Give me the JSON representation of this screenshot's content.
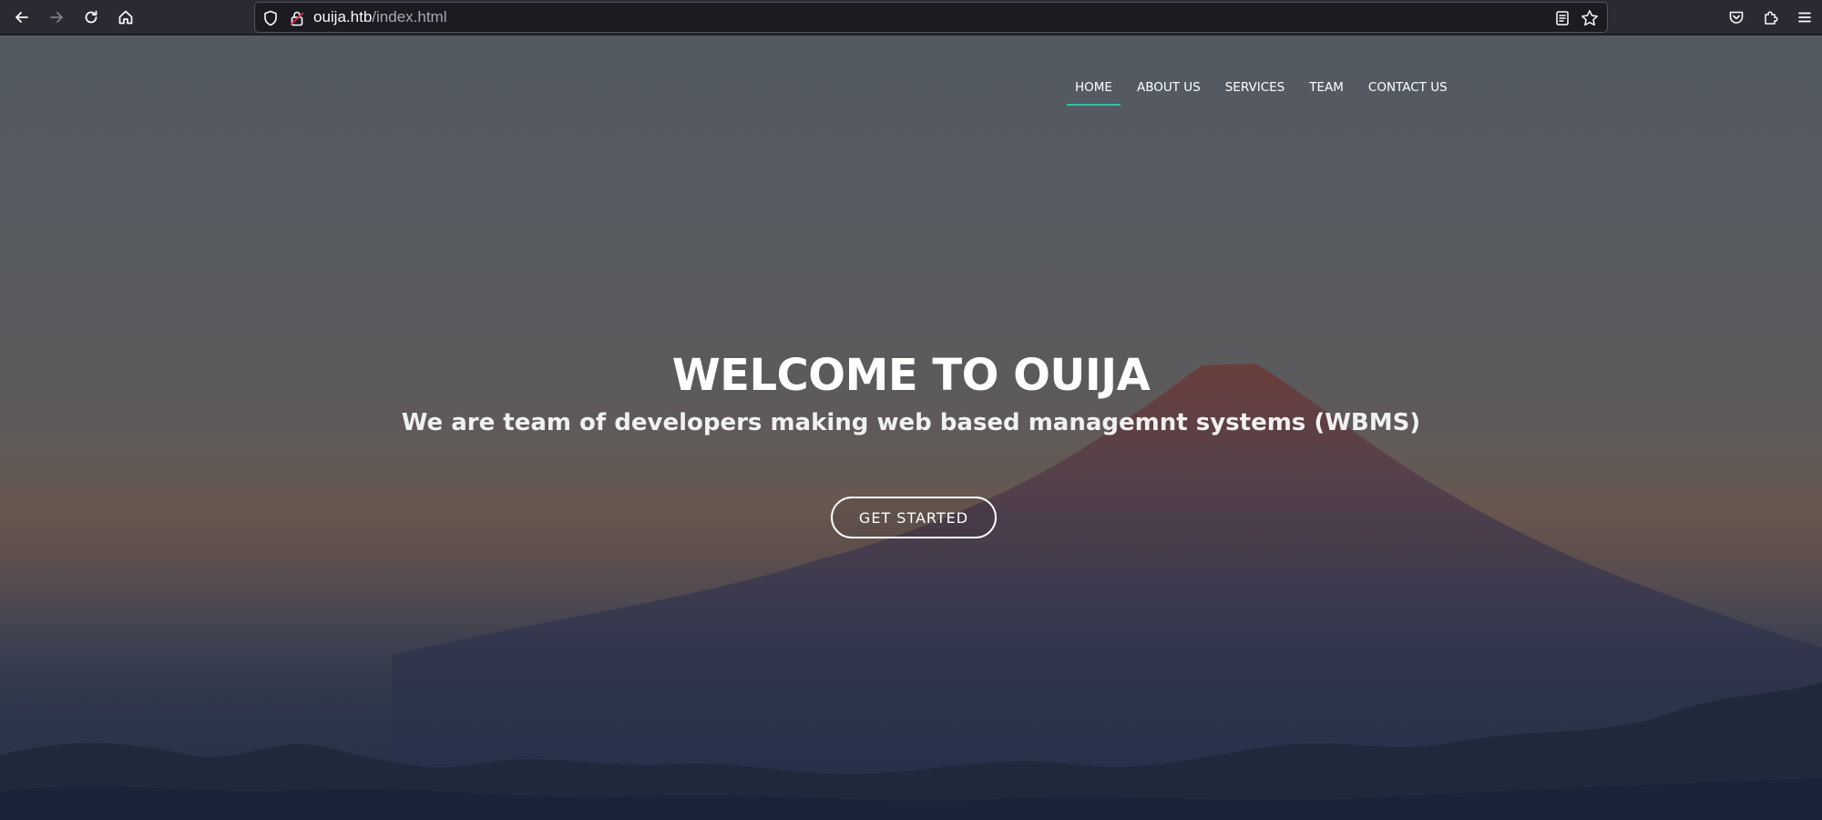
{
  "browser": {
    "url_host": "ouija.htb",
    "url_path": "/index.html",
    "icons": [
      "back-icon",
      "forward-icon",
      "reload-icon",
      "home-icon",
      "shield-icon",
      "lock-icon",
      "reader-view-icon",
      "bookmark-star-icon",
      "pocket-icon",
      "extensions-icon",
      "menu-icon"
    ]
  },
  "nav": {
    "items": [
      {
        "label": "HOME",
        "active": true
      },
      {
        "label": "ABOUT US",
        "active": false
      },
      {
        "label": "SERVICES",
        "active": false
      },
      {
        "label": "TEAM",
        "active": false
      },
      {
        "label": "CONTACT US",
        "active": false
      }
    ]
  },
  "hero": {
    "title": "WELCOME TO OUIJA",
    "subtitle": "We are team of developers making web based managemnt systems (WBMS)",
    "button_label": "GET STARTED"
  },
  "colors": {
    "nav_active_underline": "#2fc4a3",
    "browser_toolbar": "#2b2a33",
    "urlbar": "#1c1b22"
  }
}
